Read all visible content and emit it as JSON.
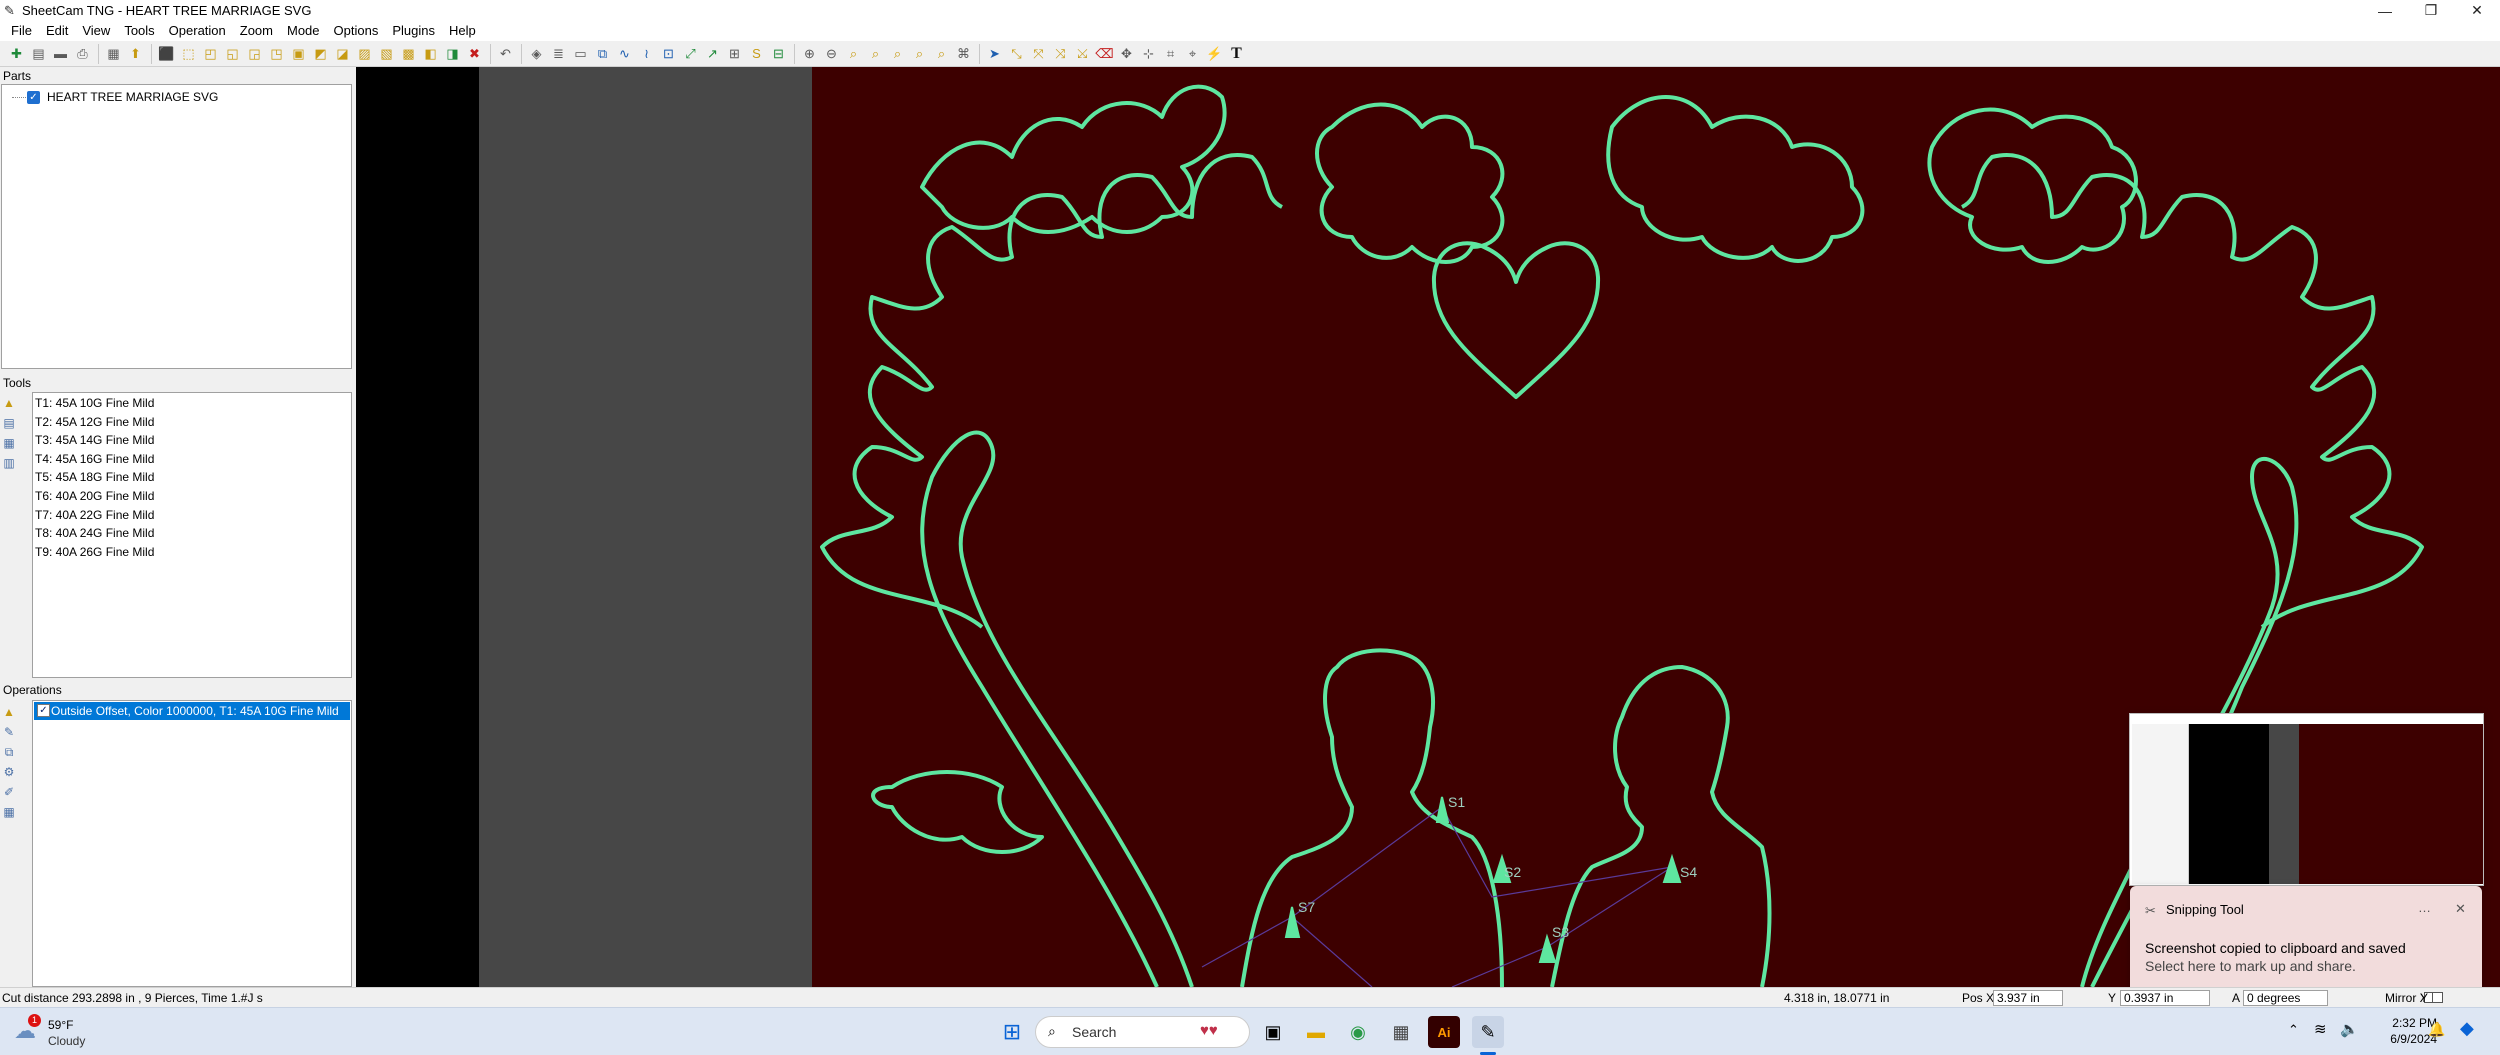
{
  "window": {
    "title": "SheetCam TNG - HEART TREE MARRIAGE SVG"
  },
  "menu": [
    "File",
    "Edit",
    "View",
    "Tools",
    "Operation",
    "Zoom",
    "Mode",
    "Options",
    "Plugins",
    "Help"
  ],
  "parts": {
    "header": "Parts",
    "items": [
      {
        "label": "HEART TREE MARRIAGE SVG",
        "checked": true
      }
    ]
  },
  "tools": {
    "header": "Tools",
    "items": [
      "T1: 45A 10G Fine Mild",
      "T2: 45A 12G Fine Mild",
      "T3: 45A 14G Fine Mild",
      "T4: 45A 16G Fine Mild",
      "T5: 45A 18G Fine Mild",
      "T6: 40A 20G Fine Mild",
      "T7: 40A 22G Fine Mild",
      "T8: 40A 24G Fine Mild",
      "T9: 40A 26G Fine Mild"
    ]
  },
  "operations": {
    "header": "Operations",
    "items": [
      {
        "label": "Outside Offset, Color 1000000, T1: 45A 10G Fine Mild",
        "selected": true
      }
    ]
  },
  "canvas": {
    "background": "#3d0000",
    "path_color": "#5ee6a0",
    "start_labels": [
      "S1",
      "S2",
      "S3",
      "S4",
      "S7"
    ]
  },
  "status": {
    "cut_info": "Cut distance 293.2898 in , 9 Pierces, Time 1.#J s",
    "cursor": "4.318 in, 18.0771 in",
    "pos_x_label": "Pos X",
    "pos_x": "3.937 in",
    "y_label": "Y",
    "y": "0.3937 in",
    "angle_label": "A",
    "angle": "0 degrees",
    "mirror_label": "Mirror X",
    "mirror_y": "Y"
  },
  "toast": {
    "app": "Snipping Tool",
    "line1": "Screenshot copied to clipboard and saved",
    "line2": "Select here to mark up and share.",
    "menu_icon": "…",
    "close_icon": "✕"
  },
  "taskbar": {
    "weather_temp": "59°F",
    "weather_cond": "Cloudy",
    "weather_badge": "1",
    "search_placeholder": "Search",
    "time": "2:32 PM",
    "date": "6/9/2024",
    "ai_label": "Ai"
  }
}
